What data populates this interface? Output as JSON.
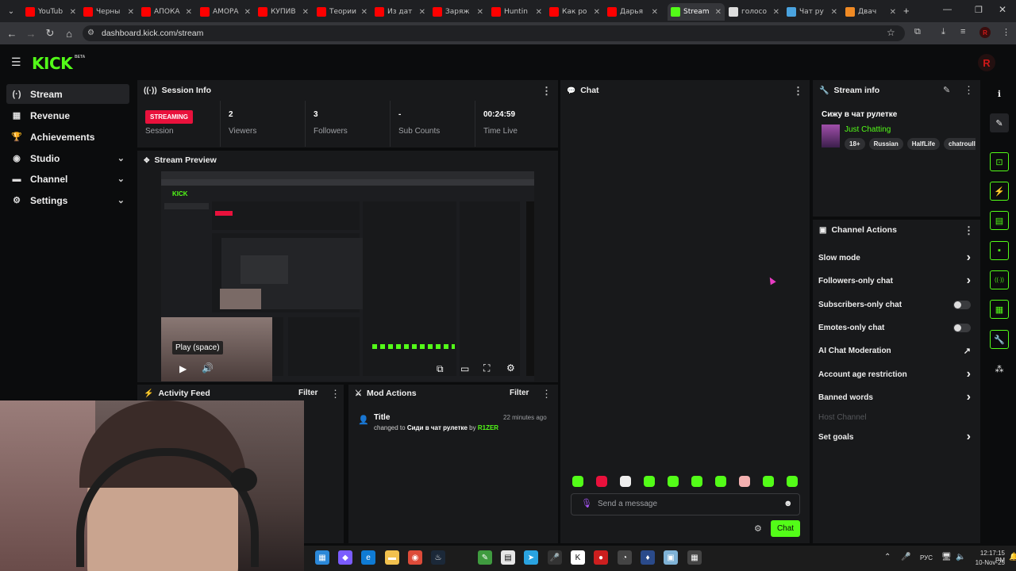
{
  "browser": {
    "tabs": [
      {
        "title": "YouTub",
        "color": "#ff0000",
        "icon": "youtube-icon"
      },
      {
        "title": "Черны",
        "color": "#ff0000",
        "icon": "youtube-icon"
      },
      {
        "title": "АПОКА",
        "color": "#ff0000",
        "icon": "youtube-icon"
      },
      {
        "title": "АМОРА",
        "color": "#ff0000",
        "icon": "youtube-icon"
      },
      {
        "title": "КУПИВ",
        "color": "#ff0000",
        "icon": "youtube-icon"
      },
      {
        "title": "Теории",
        "color": "#ff0000",
        "icon": "youtube-icon"
      },
      {
        "title": "Из дат",
        "color": "#ff0000",
        "icon": "youtube-icon"
      },
      {
        "title": "Заряж",
        "color": "#ff0000",
        "icon": "youtube-icon"
      },
      {
        "title": "Huntin",
        "color": "#ff0000",
        "icon": "youtube-icon"
      },
      {
        "title": "Как ро",
        "color": "#ff0000",
        "icon": "youtube-icon"
      },
      {
        "title": "Дарья",
        "color": "#ff0000",
        "icon": "youtube-icon"
      },
      {
        "title": "Stream",
        "color": "#53fc18",
        "icon": "kick-icon",
        "active": true
      },
      {
        "title": "голосо",
        "color": "#dddddd",
        "icon": "google-icon"
      },
      {
        "title": "Чат ру",
        "color": "#4aa3df",
        "icon": "chat-site-icon"
      },
      {
        "title": "Двач",
        "color": "#f08a24",
        "icon": "dvach-icon"
      }
    ],
    "url": "dashboard.kick.com/stream"
  },
  "app": {
    "logo": "KICK",
    "beta": "BETA",
    "avatar_letter": "R"
  },
  "sidebar": {
    "items": [
      {
        "label": "Stream",
        "icon": "stream-icon",
        "glyph": "(·)"
      },
      {
        "label": "Revenue",
        "icon": "revenue-icon",
        "glyph": "▦"
      },
      {
        "label": "Achievements",
        "icon": "trophy-icon",
        "glyph": "🏆"
      },
      {
        "label": "Studio",
        "icon": "studio-icon",
        "glyph": "◉"
      },
      {
        "label": "Channel",
        "icon": "channel-icon",
        "glyph": "▬"
      },
      {
        "label": "Settings",
        "icon": "gear-icon",
        "glyph": "⚙"
      }
    ]
  },
  "session": {
    "title": "Session Info",
    "status": "STREAMING",
    "status_label": "Session",
    "viewers": "2",
    "viewers_label": "Viewers",
    "followers": "3",
    "followers_label": "Followers",
    "subs": "-",
    "subs_label": "Sub Counts",
    "time": "00:24:59",
    "time_label": "Time Live"
  },
  "preview": {
    "title": "Stream Preview",
    "tooltip": "Play (space)"
  },
  "activity": {
    "title": "Activity Feed",
    "filter": "Filter"
  },
  "mod": {
    "title": "Mod Actions",
    "filter": "Filter",
    "entry_title": "Title",
    "entry_time": "22 minutes ago",
    "entry_prefix": "changed to",
    "entry_value": "Сиди в чат рулетке",
    "entry_by": "by",
    "entry_user": "R1ZER"
  },
  "chat": {
    "title": "Chat",
    "placeholder": "Send a message",
    "send": "Chat"
  },
  "stream_info": {
    "title": "Stream info",
    "stream_title": "Сижу в чат рулетке",
    "category": "Just Chatting",
    "tags": [
      "18+",
      "Russian",
      "HalfLife",
      "chatroull"
    ]
  },
  "channel_actions": {
    "title": "Channel Actions",
    "items": [
      {
        "label": "Slow mode",
        "type": "arrow"
      },
      {
        "label": "Followers-only chat",
        "type": "arrow"
      },
      {
        "label": "Subscribers-only chat",
        "type": "toggle",
        "on": false
      },
      {
        "label": "Emotes-only chat",
        "type": "toggle",
        "on": false
      },
      {
        "label": "AI Chat Moderation",
        "type": "external"
      },
      {
        "label": "Account age restriction",
        "type": "arrow"
      },
      {
        "label": "Banned words",
        "type": "arrow"
      },
      {
        "label": "Host Channel",
        "type": "disabled"
      },
      {
        "label": "Set goals",
        "type": "arrow"
      }
    ]
  },
  "taskbar": {
    "lang": "РУС",
    "time": "12:17:15 PM",
    "date": "10-Nov-25"
  },
  "colors": {
    "accent": "#53fc18",
    "streaming": "#e9113c",
    "panel": "#18191b"
  }
}
